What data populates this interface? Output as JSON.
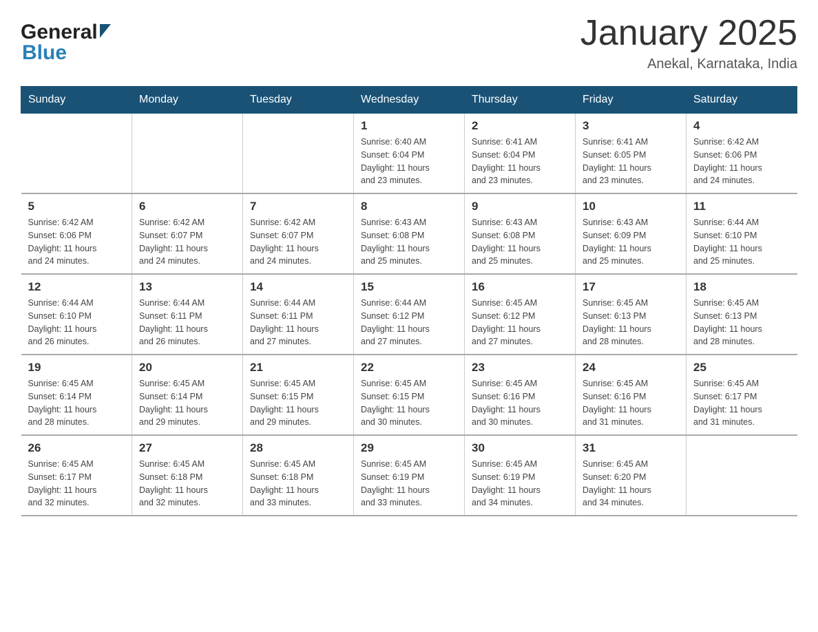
{
  "header": {
    "month_title": "January 2025",
    "location": "Anekal, Karnataka, India",
    "logo_general": "General",
    "logo_blue": "Blue"
  },
  "days_of_week": [
    "Sunday",
    "Monday",
    "Tuesday",
    "Wednesday",
    "Thursday",
    "Friday",
    "Saturday"
  ],
  "weeks": [
    [
      {
        "day": "",
        "info": ""
      },
      {
        "day": "",
        "info": ""
      },
      {
        "day": "",
        "info": ""
      },
      {
        "day": "1",
        "info": "Sunrise: 6:40 AM\nSunset: 6:04 PM\nDaylight: 11 hours\nand 23 minutes."
      },
      {
        "day": "2",
        "info": "Sunrise: 6:41 AM\nSunset: 6:04 PM\nDaylight: 11 hours\nand 23 minutes."
      },
      {
        "day": "3",
        "info": "Sunrise: 6:41 AM\nSunset: 6:05 PM\nDaylight: 11 hours\nand 23 minutes."
      },
      {
        "day": "4",
        "info": "Sunrise: 6:42 AM\nSunset: 6:06 PM\nDaylight: 11 hours\nand 24 minutes."
      }
    ],
    [
      {
        "day": "5",
        "info": "Sunrise: 6:42 AM\nSunset: 6:06 PM\nDaylight: 11 hours\nand 24 minutes."
      },
      {
        "day": "6",
        "info": "Sunrise: 6:42 AM\nSunset: 6:07 PM\nDaylight: 11 hours\nand 24 minutes."
      },
      {
        "day": "7",
        "info": "Sunrise: 6:42 AM\nSunset: 6:07 PM\nDaylight: 11 hours\nand 24 minutes."
      },
      {
        "day": "8",
        "info": "Sunrise: 6:43 AM\nSunset: 6:08 PM\nDaylight: 11 hours\nand 25 minutes."
      },
      {
        "day": "9",
        "info": "Sunrise: 6:43 AM\nSunset: 6:08 PM\nDaylight: 11 hours\nand 25 minutes."
      },
      {
        "day": "10",
        "info": "Sunrise: 6:43 AM\nSunset: 6:09 PM\nDaylight: 11 hours\nand 25 minutes."
      },
      {
        "day": "11",
        "info": "Sunrise: 6:44 AM\nSunset: 6:10 PM\nDaylight: 11 hours\nand 25 minutes."
      }
    ],
    [
      {
        "day": "12",
        "info": "Sunrise: 6:44 AM\nSunset: 6:10 PM\nDaylight: 11 hours\nand 26 minutes."
      },
      {
        "day": "13",
        "info": "Sunrise: 6:44 AM\nSunset: 6:11 PM\nDaylight: 11 hours\nand 26 minutes."
      },
      {
        "day": "14",
        "info": "Sunrise: 6:44 AM\nSunset: 6:11 PM\nDaylight: 11 hours\nand 27 minutes."
      },
      {
        "day": "15",
        "info": "Sunrise: 6:44 AM\nSunset: 6:12 PM\nDaylight: 11 hours\nand 27 minutes."
      },
      {
        "day": "16",
        "info": "Sunrise: 6:45 AM\nSunset: 6:12 PM\nDaylight: 11 hours\nand 27 minutes."
      },
      {
        "day": "17",
        "info": "Sunrise: 6:45 AM\nSunset: 6:13 PM\nDaylight: 11 hours\nand 28 minutes."
      },
      {
        "day": "18",
        "info": "Sunrise: 6:45 AM\nSunset: 6:13 PM\nDaylight: 11 hours\nand 28 minutes."
      }
    ],
    [
      {
        "day": "19",
        "info": "Sunrise: 6:45 AM\nSunset: 6:14 PM\nDaylight: 11 hours\nand 28 minutes."
      },
      {
        "day": "20",
        "info": "Sunrise: 6:45 AM\nSunset: 6:14 PM\nDaylight: 11 hours\nand 29 minutes."
      },
      {
        "day": "21",
        "info": "Sunrise: 6:45 AM\nSunset: 6:15 PM\nDaylight: 11 hours\nand 29 minutes."
      },
      {
        "day": "22",
        "info": "Sunrise: 6:45 AM\nSunset: 6:15 PM\nDaylight: 11 hours\nand 30 minutes."
      },
      {
        "day": "23",
        "info": "Sunrise: 6:45 AM\nSunset: 6:16 PM\nDaylight: 11 hours\nand 30 minutes."
      },
      {
        "day": "24",
        "info": "Sunrise: 6:45 AM\nSunset: 6:16 PM\nDaylight: 11 hours\nand 31 minutes."
      },
      {
        "day": "25",
        "info": "Sunrise: 6:45 AM\nSunset: 6:17 PM\nDaylight: 11 hours\nand 31 minutes."
      }
    ],
    [
      {
        "day": "26",
        "info": "Sunrise: 6:45 AM\nSunset: 6:17 PM\nDaylight: 11 hours\nand 32 minutes."
      },
      {
        "day": "27",
        "info": "Sunrise: 6:45 AM\nSunset: 6:18 PM\nDaylight: 11 hours\nand 32 minutes."
      },
      {
        "day": "28",
        "info": "Sunrise: 6:45 AM\nSunset: 6:18 PM\nDaylight: 11 hours\nand 33 minutes."
      },
      {
        "day": "29",
        "info": "Sunrise: 6:45 AM\nSunset: 6:19 PM\nDaylight: 11 hours\nand 33 minutes."
      },
      {
        "day": "30",
        "info": "Sunrise: 6:45 AM\nSunset: 6:19 PM\nDaylight: 11 hours\nand 34 minutes."
      },
      {
        "day": "31",
        "info": "Sunrise: 6:45 AM\nSunset: 6:20 PM\nDaylight: 11 hours\nand 34 minutes."
      },
      {
        "day": "",
        "info": ""
      }
    ]
  ]
}
